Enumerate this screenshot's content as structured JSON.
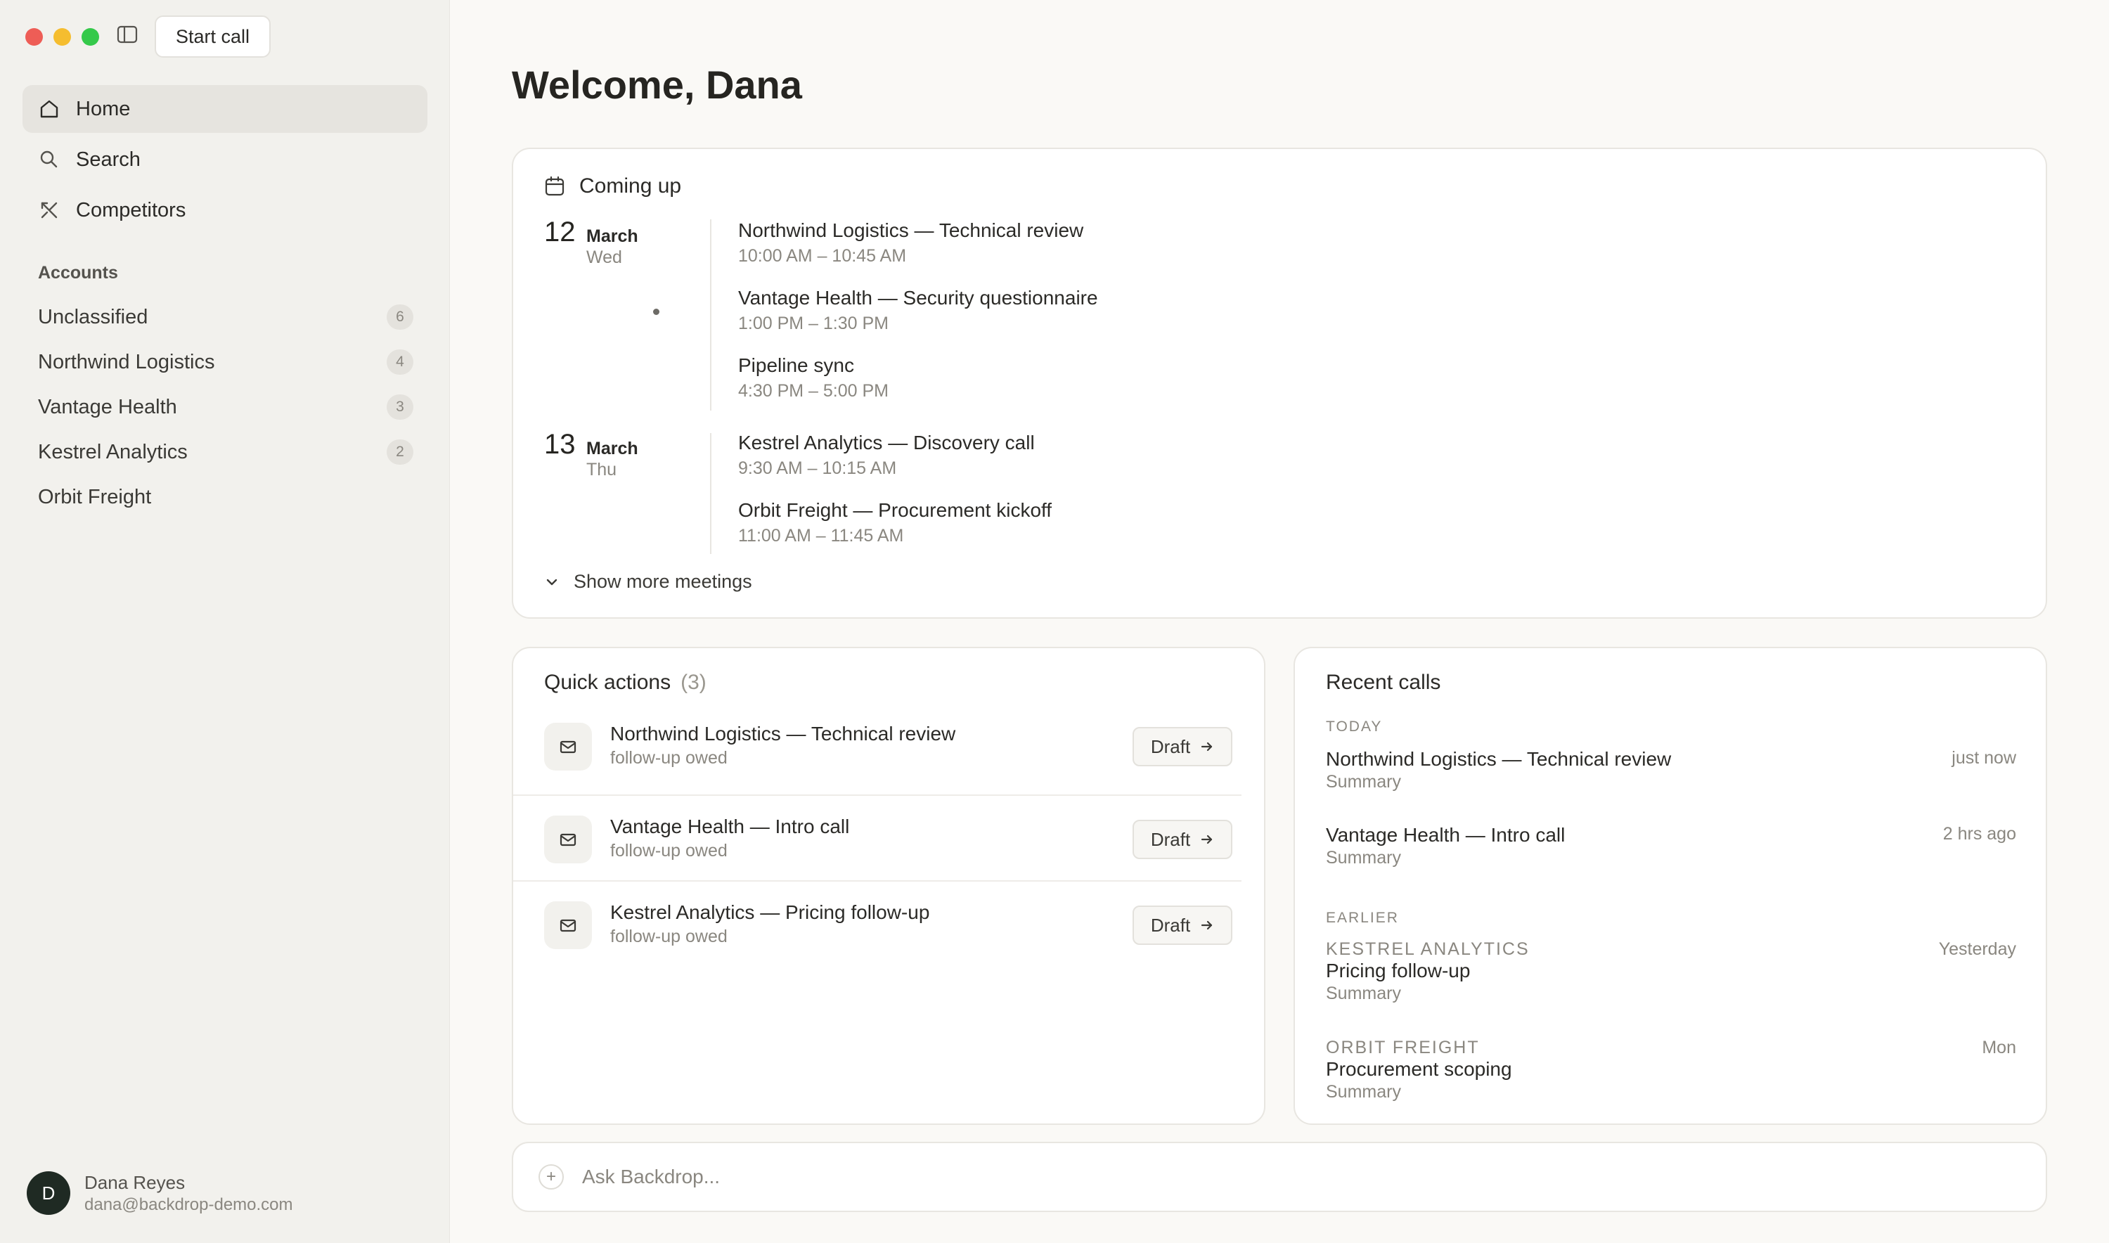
{
  "window": {
    "start_call": "Start call"
  },
  "sidebar": {
    "nav": [
      {
        "label": "Home",
        "icon": "home-icon"
      },
      {
        "label": "Search",
        "icon": "search-icon"
      },
      {
        "label": "Competitors",
        "icon": "competitors-icon"
      }
    ],
    "accounts_label": "Accounts",
    "accounts": [
      {
        "name": "Unclassified",
        "count": "6"
      },
      {
        "name": "Northwind Logistics",
        "count": "4"
      },
      {
        "name": "Vantage Health",
        "count": "3"
      },
      {
        "name": "Kestrel Analytics",
        "count": "2"
      },
      {
        "name": "Orbit Freight"
      }
    ],
    "user": {
      "initial": "D",
      "name": "Dana Reyes",
      "email": "dana@backdrop-demo.com"
    }
  },
  "main": {
    "welcome": "Welcome, Dana",
    "coming_up": {
      "title": "Coming up",
      "days": [
        {
          "day": "12",
          "month": "March",
          "weekday": "Wed",
          "meetings": [
            {
              "title": "Northwind Logistics — Technical review",
              "time": "10:00 AM – 10:45 AM"
            },
            {
              "title": "Vantage Health — Security questionnaire",
              "time": "1:00 PM – 1:30 PM"
            },
            {
              "title": "Pipeline sync",
              "time": "4:30 PM – 5:00 PM"
            }
          ]
        },
        {
          "day": "13",
          "month": "March",
          "weekday": "Thu",
          "meetings": [
            {
              "title": "Kestrel Analytics — Discovery call",
              "time": "9:30 AM – 10:15 AM"
            },
            {
              "title": "Orbit Freight — Procurement kickoff",
              "time": "11:00 AM – 11:45 AM"
            }
          ]
        }
      ],
      "show_more": "Show more meetings"
    },
    "quick_actions": {
      "title": "Quick actions",
      "count": "(3)",
      "items": [
        {
          "title": "Northwind Logistics — Technical review",
          "sub": "follow-up owed",
          "button": "Draft"
        },
        {
          "title": "Vantage Health — Intro call",
          "sub": "follow-up owed",
          "button": "Draft"
        },
        {
          "title": "Kestrel Analytics — Pricing follow-up",
          "sub": "follow-up owed",
          "button": "Draft"
        }
      ]
    },
    "recent_calls": {
      "title": "Recent calls",
      "today_label": "TODAY",
      "earlier_label": "EARLIER",
      "today": [
        {
          "title": "Northwind Logistics — Technical review",
          "summary": "Summary",
          "time": "just now"
        },
        {
          "title": "Vantage Health — Intro call",
          "summary": "Summary",
          "time": "2 hrs ago"
        }
      ],
      "earlier": [
        {
          "account": "KESTREL ANALYTICS",
          "title": "Pricing follow-up",
          "summary": "Summary",
          "time": "Yesterday"
        },
        {
          "account": "ORBIT FREIGHT",
          "title": "Procurement scoping",
          "summary": "Summary",
          "time": "Mon"
        }
      ]
    },
    "ask": {
      "placeholder": "Ask Backdrop..."
    }
  }
}
